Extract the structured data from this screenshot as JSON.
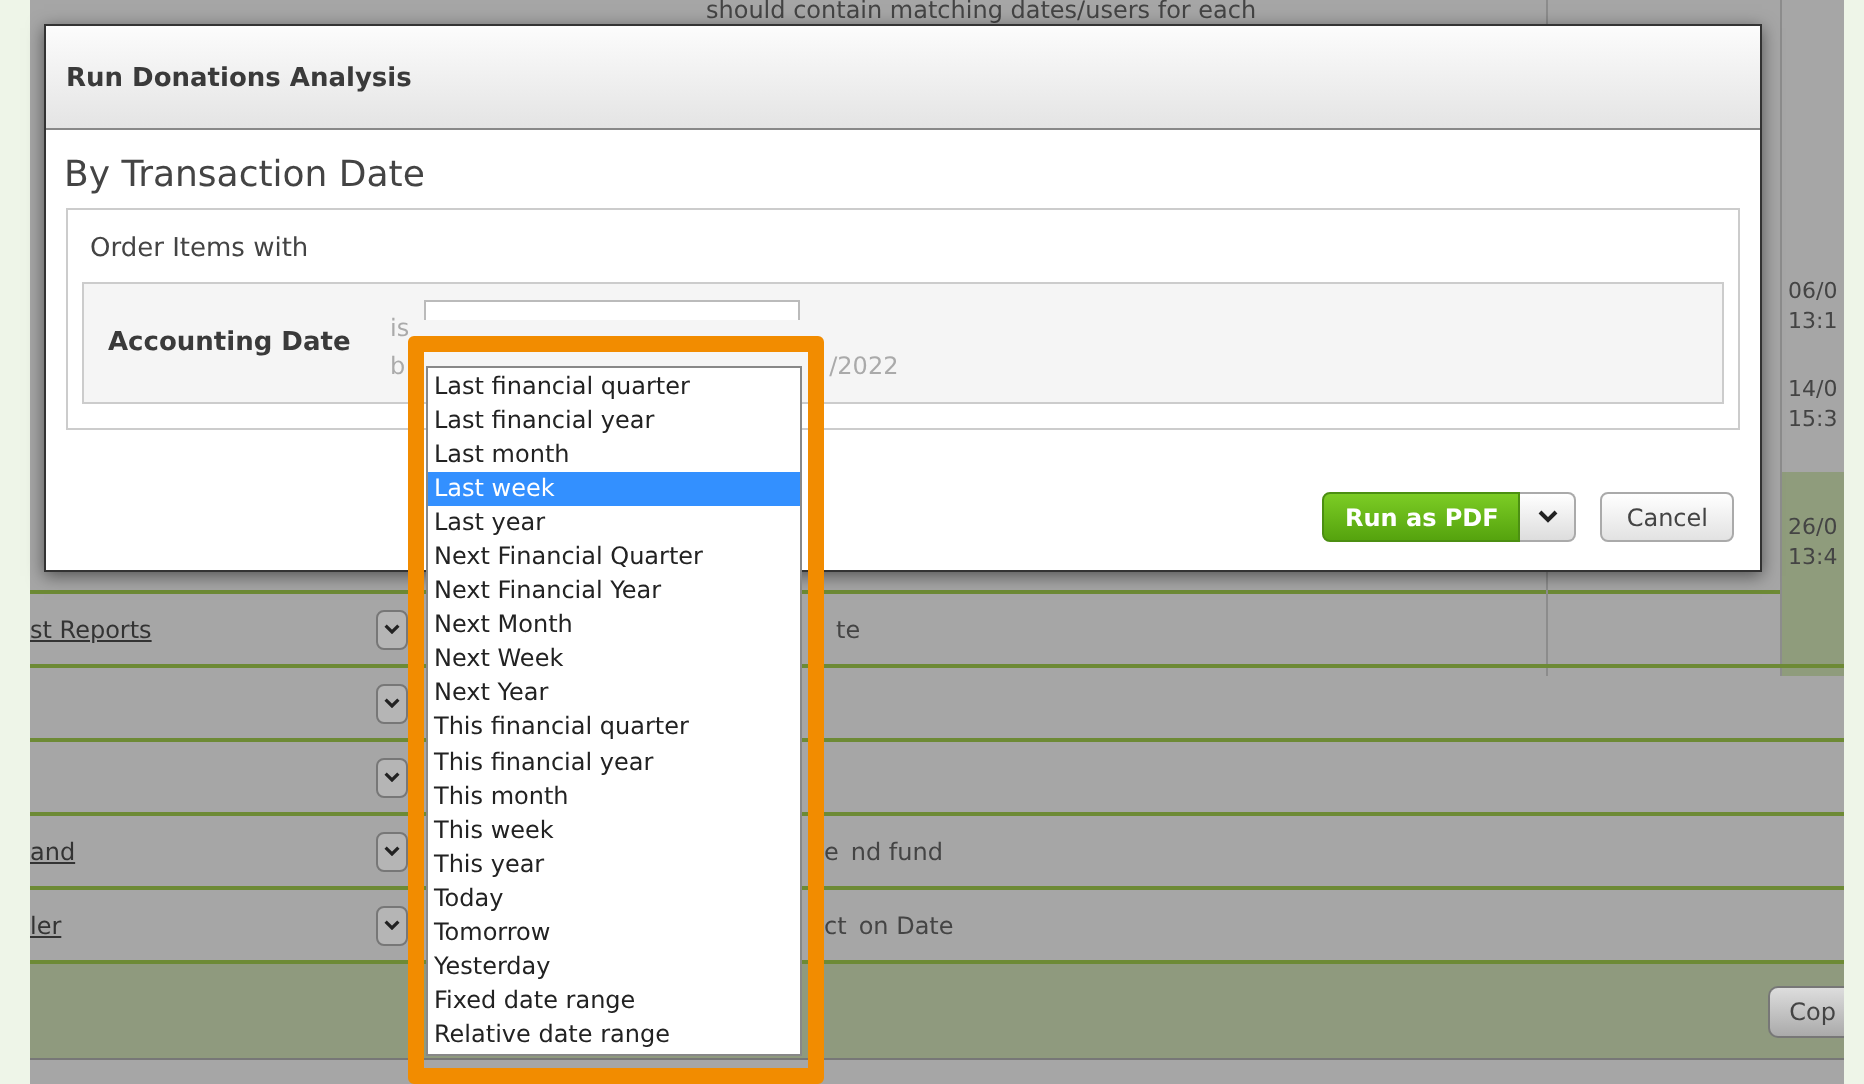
{
  "background": {
    "top_note": "should contain matching dates/users for each",
    "dates": [
      {
        "date": "06/0",
        "time": "13:1",
        "highlighted": false
      },
      {
        "date": "14/0",
        "time": "15:3",
        "highlighted": false
      },
      {
        "date": "26/0",
        "time": "13:4",
        "highlighted": true
      }
    ],
    "rows": [
      {
        "link": "st Reports",
        "text_right": "te"
      },
      {},
      {},
      {
        "link": "and",
        "text_left": "e",
        "text_right": "nd fund"
      },
      {
        "link": "ler",
        "text_left": "ct",
        "text_right": "on Date"
      }
    ],
    "copy_button": "Cop"
  },
  "dialog": {
    "title": "Run Donations Analysis",
    "section_title": "By Transaction Date",
    "group_label": "Order Items with",
    "field_label": "Accounting Date",
    "operator": "is",
    "second_prefix": "b",
    "second_value": "/2022",
    "run_button": "Run as PDF",
    "cancel_button": "Cancel"
  },
  "dropdown": {
    "options": [
      {
        "label": "Last financial quarter",
        "selected": false
      },
      {
        "label": "Last financial year",
        "selected": false
      },
      {
        "label": "Last month",
        "selected": false
      },
      {
        "label": "Last week",
        "selected": true
      },
      {
        "label": "Last year",
        "selected": false
      },
      {
        "label": "Next Financial Quarter",
        "selected": false
      },
      {
        "label": "Next Financial Year",
        "selected": false
      },
      {
        "label": "Next Month",
        "selected": false
      },
      {
        "label": "Next Week",
        "selected": false
      },
      {
        "label": "Next Year",
        "selected": false
      },
      {
        "label": "This financial quarter",
        "selected": false
      },
      {
        "label": "This financial year",
        "selected": false
      },
      {
        "label": "This month",
        "selected": false
      },
      {
        "label": "This week",
        "selected": false
      },
      {
        "label": "This year",
        "selected": false
      },
      {
        "label": "Today",
        "selected": false
      },
      {
        "label": "Tomorrow",
        "selected": false
      },
      {
        "label": "Yesterday",
        "selected": false
      },
      {
        "label": "Fixed date range",
        "selected": false
      },
      {
        "label": "Relative date range",
        "selected": false
      }
    ]
  }
}
